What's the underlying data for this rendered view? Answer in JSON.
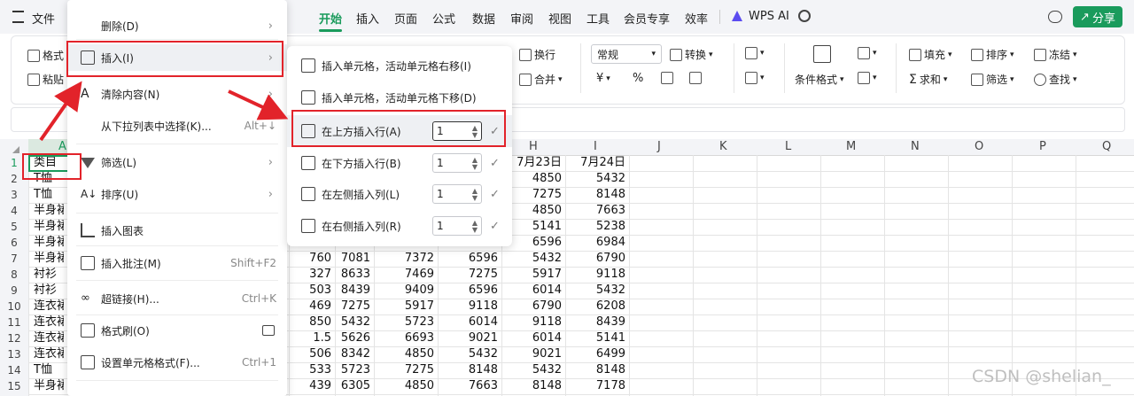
{
  "topbar": {
    "file_label": "文件",
    "tabs": [
      "开始",
      "插入",
      "页面",
      "公式",
      "数据",
      "审阅",
      "视图",
      "工具",
      "会员专享",
      "效率"
    ],
    "wps_ai": "WPS AI",
    "share_label": "分享"
  },
  "ribbon": {
    "format_label": "格式",
    "paste_label": "粘贴",
    "wrap_label": "换行",
    "merge_label": "合并",
    "number_format": "常规",
    "convert_label": "转换",
    "currency_symbol": "¥",
    "percent_symbol": "%",
    "cond_format_label": "条件格式",
    "fill_label": "填充",
    "sort_label": "排序",
    "freeze_label": "冻结",
    "sum_label": "求和",
    "filter_label": "筛选",
    "find_label": "查找"
  },
  "grid": {
    "col_headers": [
      "A",
      "H",
      "I",
      "J",
      "K",
      "L",
      "M",
      "N",
      "O",
      "P",
      "Q"
    ],
    "row_numbers": [
      "1",
      "2",
      "3",
      "4",
      "5",
      "6",
      "7",
      "8",
      "9",
      "10",
      "11",
      "12",
      "13",
      "14",
      "15"
    ],
    "col_a": [
      "类目",
      "T恤",
      "T恤",
      "半身裙",
      "半身裙",
      "半身裙",
      "半身裙",
      "衬衫",
      "衬衫",
      "连衣裙",
      "连衣裙",
      "连衣裙",
      "连衣裙",
      "T恤",
      "半身裙"
    ],
    "col_e": [
      "",
      "",
      "",
      "",
      "",
      "",
      "760",
      "327",
      "503",
      "469",
      "850",
      "1.5",
      "506",
      "533",
      "439"
    ],
    "col_f": [
      "",
      "",
      "",
      "",
      "",
      "",
      "7081",
      "8633",
      "8439",
      "7275",
      "5432",
      "5626",
      "8342",
      "5723",
      "6305"
    ],
    "col_g1": [
      "",
      "",
      "",
      "",
      "",
      "",
      "7372",
      "7469",
      "9409",
      "5917",
      "5723",
      "6693",
      "4850",
      "7275",
      "4850"
    ],
    "col_g2": [
      "",
      "",
      "",
      "",
      "",
      "",
      "6596",
      "7275",
      "6596",
      "9118",
      "6014",
      "9021",
      "5432",
      "8148",
      "7663"
    ],
    "col_h": [
      "7月23日",
      "4850",
      "7275",
      "4850",
      "5141",
      "6596",
      "5432",
      "5917",
      "6014",
      "6790",
      "9118",
      "6014",
      "9021",
      "5432",
      "8148"
    ],
    "col_i": [
      "7月24日",
      "5432",
      "8148",
      "7663",
      "5238",
      "6984",
      "6790",
      "9118",
      "5432",
      "6208",
      "8439",
      "5141",
      "6499",
      "8148",
      "7178"
    ]
  },
  "context_menu": {
    "items": [
      {
        "label": "删除(D)",
        "shortcut": "",
        "arrow": "›"
      },
      {
        "label": "插入(I)",
        "shortcut": "",
        "arrow": "›"
      },
      {
        "label": "清除内容(N)",
        "shortcut": "",
        "arrow": "›"
      },
      {
        "label": "从下拉列表中选择(K)...",
        "shortcut": "Alt+↓",
        "arrow": ""
      },
      {
        "label": "筛选(L)",
        "shortcut": "",
        "arrow": "›"
      },
      {
        "label": "排序(U)",
        "shortcut": "",
        "arrow": "›"
      },
      {
        "label": "插入图表",
        "shortcut": "",
        "arrow": ""
      },
      {
        "label": "插入批注(M)",
        "shortcut": "Shift+F2",
        "arrow": ""
      },
      {
        "label": "超链接(H)...",
        "shortcut": "Ctrl+K",
        "arrow": ""
      },
      {
        "label": "格式刷(O)",
        "shortcut": "",
        "arrow": ""
      },
      {
        "label": "设置单元格格式(F)...",
        "shortcut": "Ctrl+1",
        "arrow": ""
      }
    ]
  },
  "submenu": {
    "items": [
      {
        "label": "插入单元格，活动单元格右移(I)"
      },
      {
        "label": "插入单元格，活动单元格下移(D)"
      },
      {
        "label": "在上方插入行(A)",
        "value": "1"
      },
      {
        "label": "在下方插入行(B)",
        "value": "1"
      },
      {
        "label": "在左侧插入列(L)",
        "value": "1"
      },
      {
        "label": "在右侧插入列(R)",
        "value": "1"
      }
    ],
    "check": "✓"
  },
  "watermark": "CSDN @shelian_"
}
